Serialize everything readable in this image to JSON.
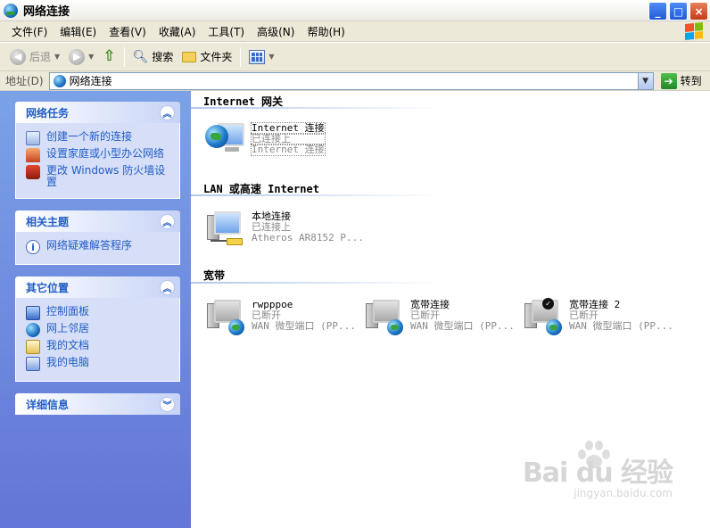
{
  "window": {
    "title": "网络连接",
    "buttons": [
      "_",
      "□",
      "×"
    ]
  },
  "menu": [
    "文件(F)",
    "编辑(E)",
    "查看(V)",
    "收藏(A)",
    "工具(T)",
    "高级(N)",
    "帮助(H)"
  ],
  "toolbar": {
    "back": "后退",
    "search": "搜索",
    "folders": "文件夹"
  },
  "address": {
    "label": "地址(D)",
    "value": "网络连接",
    "go": "转到"
  },
  "taskpane": {
    "network_tasks": {
      "title": "网络任务",
      "items": [
        "创建一个新的连接",
        "设置家庭或小型办公网络",
        "更改 Windows 防火墙设置"
      ]
    },
    "related": {
      "title": "相关主题",
      "items": [
        "网络疑难解答程序"
      ]
    },
    "other_places": {
      "title": "其它位置",
      "items": [
        "控制面板",
        "网上邻居",
        "我的文档",
        "我的电脑"
      ]
    },
    "details": {
      "title": "详细信息"
    }
  },
  "groups": {
    "internet": {
      "title": "Internet 网关",
      "conn": {
        "name": "Internet 连接",
        "status": "已连接上",
        "device": "Internet 连接"
      }
    },
    "lan": {
      "title": "LAN 或高速 Internet",
      "conn": {
        "name": "本地连接",
        "status": "已连接上",
        "device": "Atheros AR8152 P..."
      }
    },
    "broadband": {
      "title": "宽带",
      "conns": [
        {
          "name": "rwpppoe",
          "status": "已断开",
          "device": "WAN 微型端口 (PP..."
        },
        {
          "name": "宽带连接",
          "status": "已断开",
          "device": "WAN 微型端口 (PP..."
        },
        {
          "name": "宽带连接 2",
          "status": "已断开",
          "device": "WAN 微型端口 (PP..."
        }
      ]
    }
  },
  "watermark": {
    "main": "Bai du 经验",
    "sub": "jingyan.baidu.com"
  }
}
